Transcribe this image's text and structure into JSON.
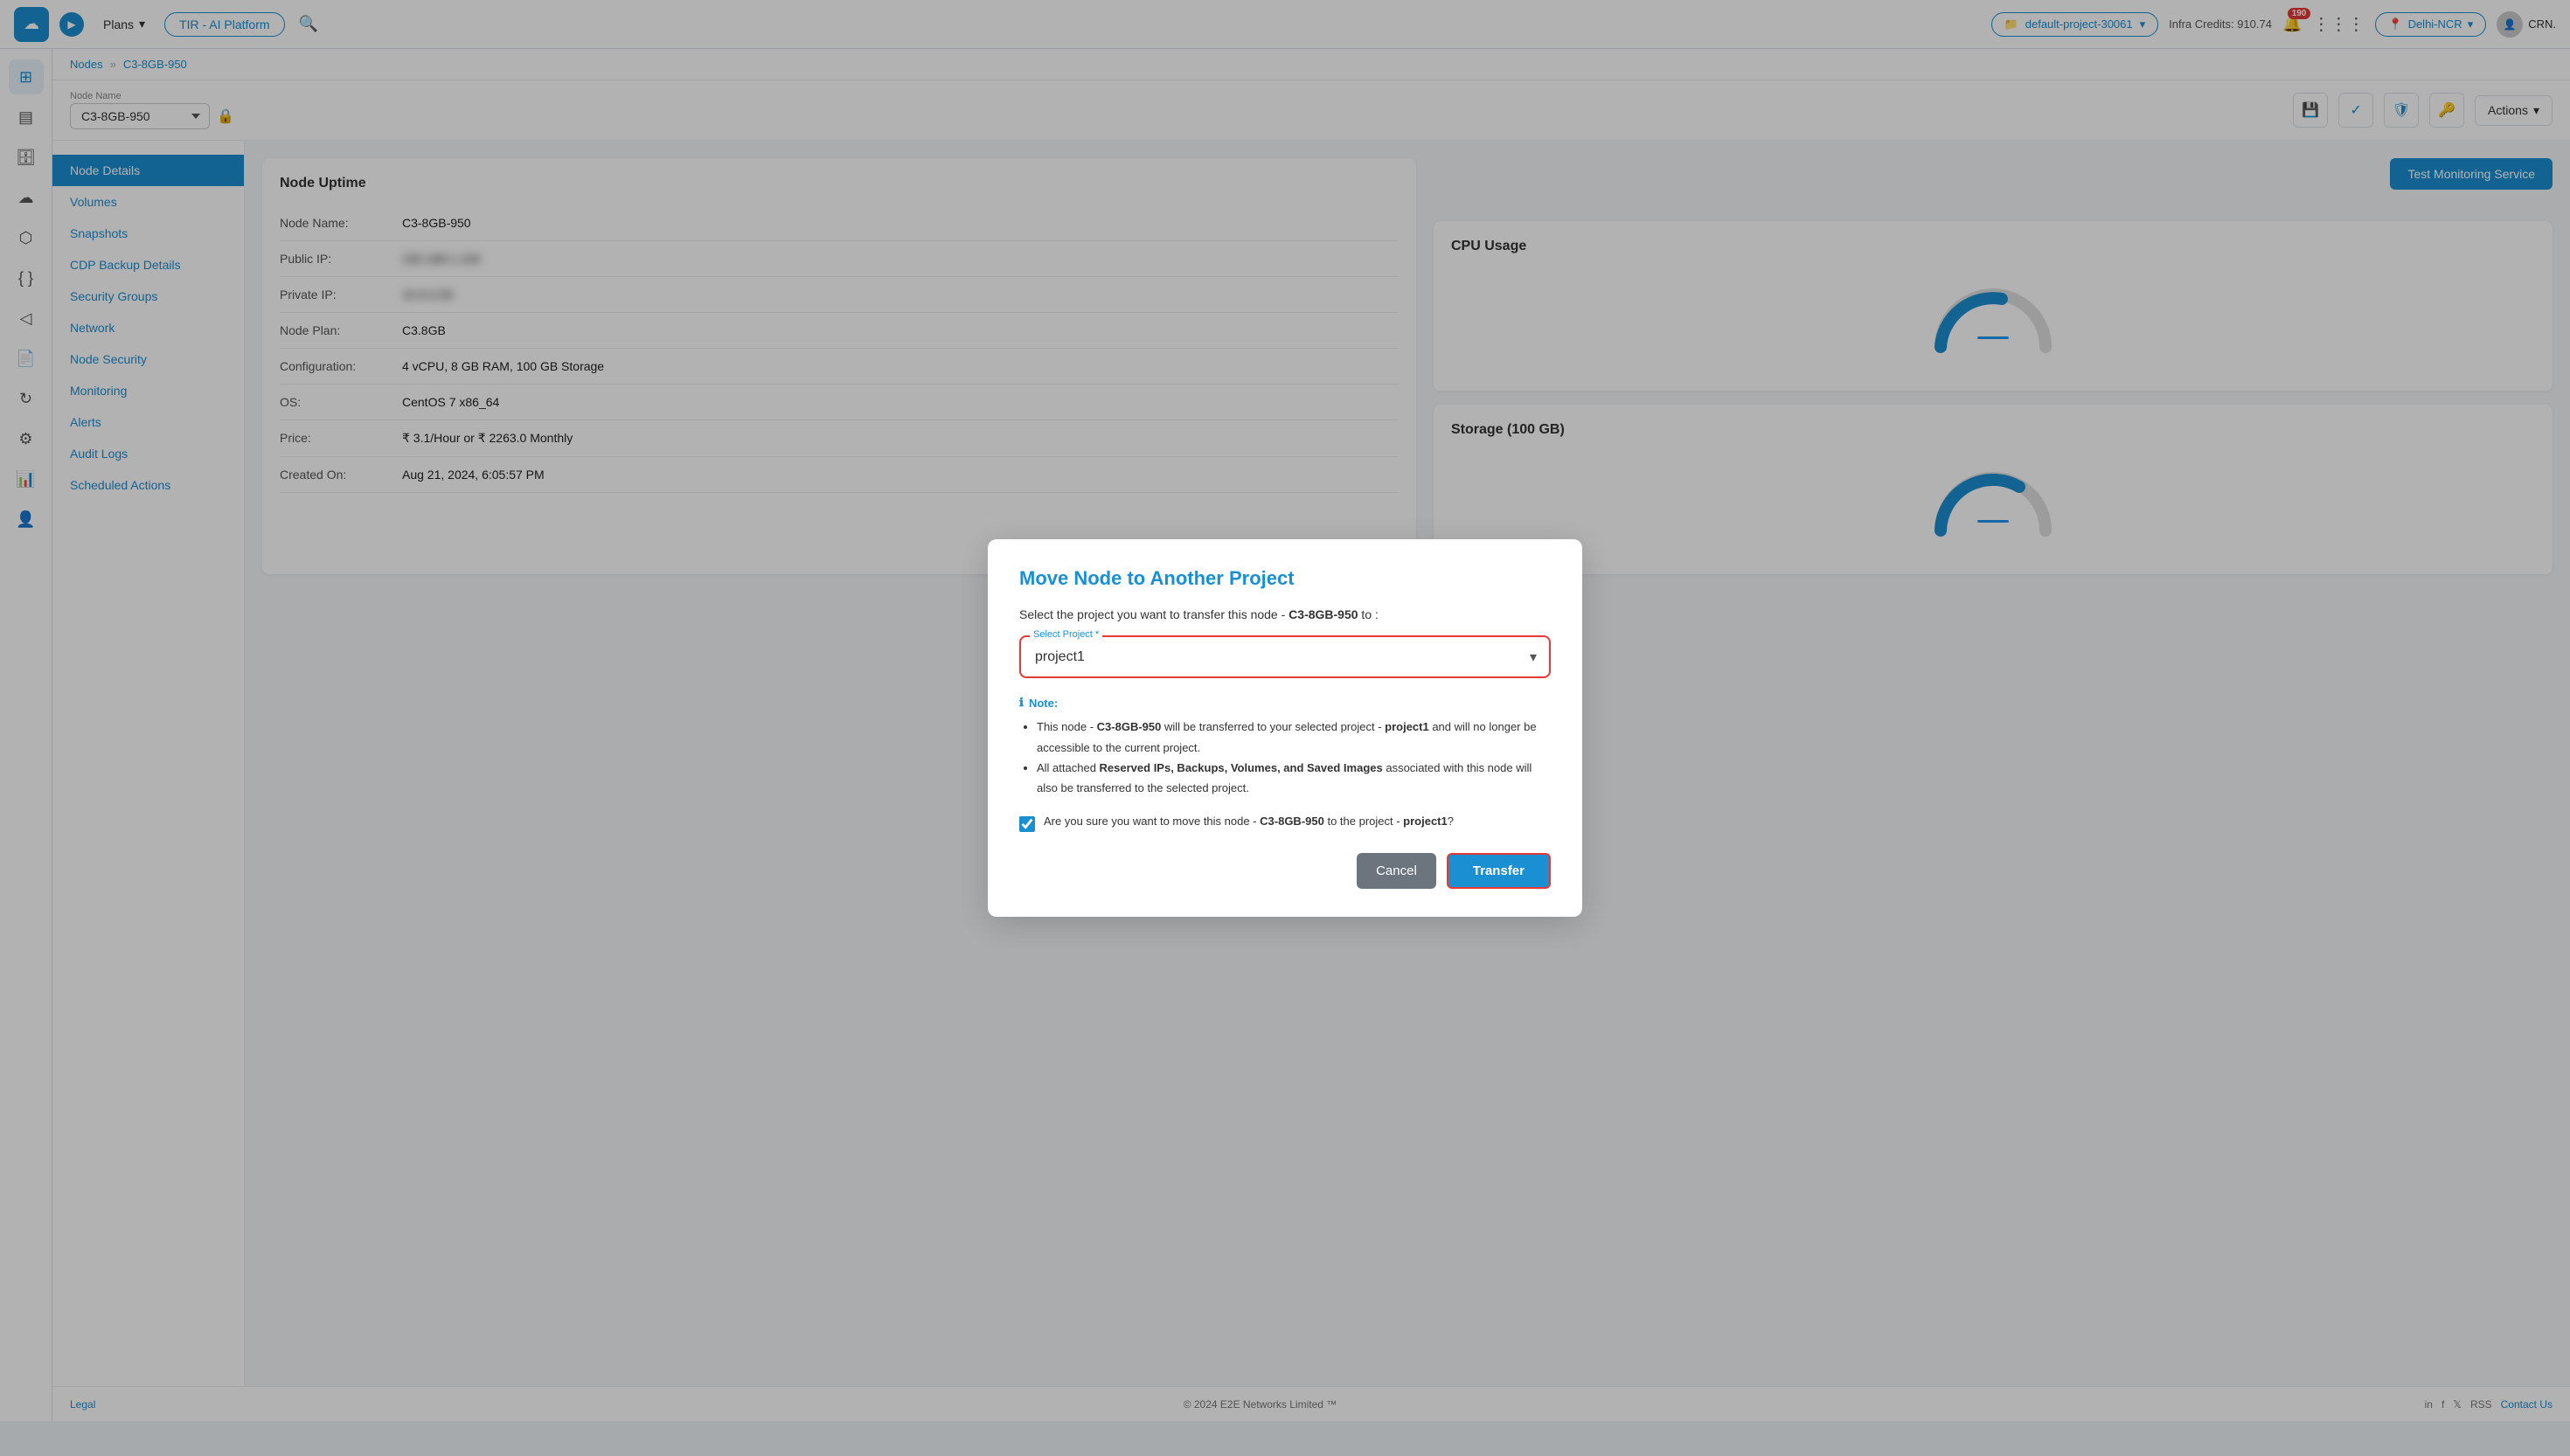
{
  "app": {
    "logo_text": "☁",
    "plans_label": "Plans",
    "tir_label": "TIR - AI Platform",
    "search_placeholder": "Search...",
    "project": "default-project-30061",
    "infra_credits_label": "Infra Credits:",
    "infra_credits_value": "910.74",
    "notif_count": "190",
    "location": "Delhi-NCR",
    "user": "CRN."
  },
  "breadcrumb": {
    "nodes": "Nodes",
    "separator": "»",
    "current": "C3-8GB-950"
  },
  "node_header": {
    "name_label": "Node Name",
    "node_name": "C3-8GB-950",
    "actions_label": "Actions"
  },
  "left_nav": {
    "items": [
      {
        "id": "node-details",
        "label": "Node Details",
        "active": true
      },
      {
        "id": "volumes",
        "label": "Volumes",
        "active": false
      },
      {
        "id": "snapshots",
        "label": "Snapshots",
        "active": false
      },
      {
        "id": "cdp-backup",
        "label": "CDP Backup Details",
        "active": false
      },
      {
        "id": "security-groups",
        "label": "Security Groups",
        "active": false
      },
      {
        "id": "network",
        "label": "Network",
        "active": false
      },
      {
        "id": "node-security",
        "label": "Node Security",
        "active": false
      },
      {
        "id": "monitoring",
        "label": "Monitoring",
        "active": false
      },
      {
        "id": "alerts",
        "label": "Alerts",
        "active": false
      },
      {
        "id": "audit-logs",
        "label": "Audit Logs",
        "active": false
      },
      {
        "id": "scheduled-actions",
        "label": "Scheduled Actions",
        "active": false
      }
    ]
  },
  "node_details": {
    "section_title": "Node Uptime",
    "fields": [
      {
        "label": "Node Name:",
        "value": "C3-8GB-950"
      },
      {
        "label": "Public IP:",
        "value": "●●●●●●●●●●"
      },
      {
        "label": "Private IP:",
        "value": "●●●●●●●●●●"
      },
      {
        "label": "Node Plan:",
        "value": "C3.8GB"
      },
      {
        "label": "Configuration:",
        "value": "4 vCPU, 8 GB RAM, 100 GB Storage"
      },
      {
        "label": "OS:",
        "value": "CentOS 7 x86_64"
      },
      {
        "label": "Price:",
        "value": "₹ 3.1/Hour or ₹ 2263.0 Monthly"
      },
      {
        "label": "Created On:",
        "value": "Aug 21, 2024, 6:05:57 PM"
      }
    ],
    "storage_label": "Storage (100 GB)",
    "test_monitoring_btn": "Test Monitoring Service"
  },
  "modal": {
    "title": "Move Node to Another Project",
    "desc_prefix": "Select the project you want to transfer this node - ",
    "node_name": "C3-8GB-950",
    "desc_suffix": " to :",
    "select_label": "Select Project *",
    "selected_project": "project1",
    "note_title": "Note:",
    "note_items": [
      "This node - <strong>C3-8GB-950</strong> will be transferred to your selected project - <strong>project1</strong> and will no longer be accessible to the current project.",
      "All attached <strong>Reserved IPs, Backups, Volumes, and Saved Images</strong> associated with this node will also be transferred to the selected project."
    ],
    "confirm_text": "Are you sure you want to move this node - C3-8GB-950 to the project - project1?",
    "confirm_node": "C3-8GB-950",
    "confirm_project": "project1",
    "cancel_label": "Cancel",
    "transfer_label": "Transfer"
  },
  "footer": {
    "legal": "Legal",
    "copyright": "© 2024 E2E Networks Limited ™",
    "contact": "Contact Us"
  },
  "sidebar_icons": [
    {
      "id": "dashboard",
      "icon": "⊞"
    },
    {
      "id": "table",
      "icon": "▤"
    },
    {
      "id": "database",
      "icon": "🗄"
    },
    {
      "id": "cloud",
      "icon": "☁"
    },
    {
      "id": "network",
      "icon": "⬡"
    },
    {
      "id": "code",
      "icon": "{ }"
    },
    {
      "id": "arrow",
      "icon": "◁"
    },
    {
      "id": "file",
      "icon": "📄"
    },
    {
      "id": "refresh",
      "icon": "↻"
    },
    {
      "id": "analytics",
      "icon": "📊"
    },
    {
      "id": "user-plus",
      "icon": "👤+"
    }
  ]
}
